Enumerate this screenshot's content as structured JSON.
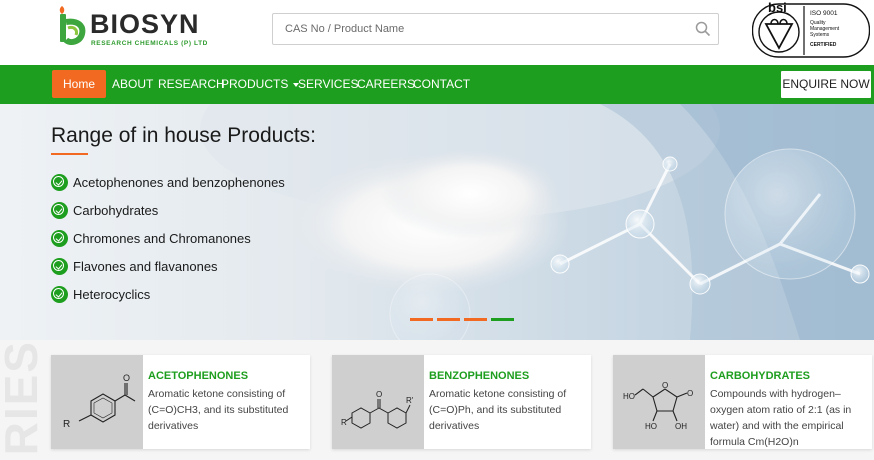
{
  "brand": {
    "name": "BIOSYN",
    "tagline": "RESEARCH CHEMICALS (P) LTD"
  },
  "search": {
    "placeholder": "CAS No / Product Name"
  },
  "certification": {
    "bsi": "bsi",
    "iso": "ISO 9001",
    "line1": "Quality",
    "line2": "Management",
    "line3": "Systems",
    "certified": "CERTIFIED"
  },
  "nav": {
    "home": "Home",
    "about": "ABOUT",
    "research": "RESEARCH",
    "products": "PRODUCTS",
    "services": "SERVICES",
    "careers": "CAREERS",
    "contact": "CONTACT",
    "enquire": "ENQUIRE NOW"
  },
  "hero": {
    "title": "Range of in house Products:",
    "items": [
      "Acetophenones and benzophenones",
      "Carbohydrates",
      "Chromones and Chromanones",
      "Flavones and flavanones",
      "Heterocyclics"
    ],
    "slides": 4,
    "active_slide": 4
  },
  "section": {
    "watermark": "RIES"
  },
  "cards": [
    {
      "title": "ACETOPHENONES",
      "description": "Aromatic ketone consisting of (C=O)CH3, and its substituted derivatives"
    },
    {
      "title": "BENZOPHENONES",
      "description": "Aromatic ketone consisting of (C=O)Ph, and its substituted derivatives"
    },
    {
      "title": "CARBOHYDRATES",
      "description": "Compounds with hydrogen–oxygen atom ratio of 2:1 (as in water) and with the empirical formula Cm(H2O)n"
    }
  ],
  "colors": {
    "brand_green": "#1e9e1e",
    "accent_orange": "#f26a21"
  }
}
